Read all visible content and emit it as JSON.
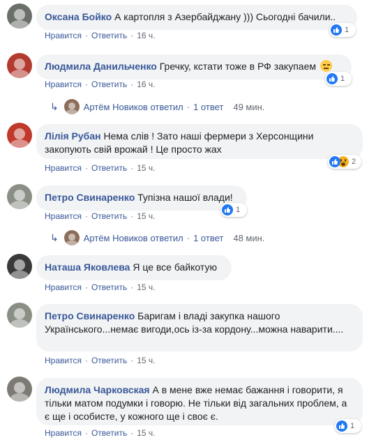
{
  "actions": {
    "like": "Нравится",
    "reply": "Ответить"
  },
  "comments": [
    {
      "author": "Оксана Бойко",
      "text": "А картопля з Азербайджану ))) Сьогодні бачили..",
      "time": "16 ч.",
      "reactions": "1",
      "avatar_color": "#6b6f6a"
    },
    {
      "author": "Людмила Данильченко",
      "text": "Гречку, кстати тоже в РФ закупаем",
      "time": "16 ч.",
      "reactions": "1",
      "avatar_color": "#b33a2f"
    },
    {
      "author": "Лілія Рубан",
      "text": "Нема слів ! Зато наші фермери з Херсонщини закопують свій врожай ! Це просто жах",
      "time": "15 ч.",
      "reactions": "2",
      "avatar_color": "#c0392b"
    },
    {
      "author": "Петро Свинаренко",
      "text": "Тупізна нашої влади!",
      "time": "15 ч.",
      "reactions": "1",
      "avatar_color": "#8a8f86"
    },
    {
      "author": "Наташа Яковлева",
      "text": "Я це все байкотую",
      "time": "15 ч.",
      "reactions": "",
      "avatar_color": "#3a3a3a"
    },
    {
      "author": "Петро Свинаренко",
      "text": "Баригам і владі закупка нашого Українського...немає вигоди,ось із-за кордону...можна наварити....",
      "time": "15 ч.",
      "reactions": "",
      "avatar_color": "#8a8f86"
    },
    {
      "author": "Людмила Чарковская",
      "text": "А в мене вже немає бажання і говорити, я тільки матом подумки і говорю. Не тільки від загальних проблем, а є ще і особисте, у кожного ще і своє є.",
      "time": "15 ч.",
      "reactions": "1",
      "avatar_color": "#7d7a75"
    }
  ],
  "replies": [
    {
      "author": "Артём Новиков",
      "verb": "ответил",
      "count": "1 ответ",
      "time": "49 мин.",
      "avatar_color": "#8c6d5a"
    },
    {
      "author": "Артём Новиков",
      "verb": "ответил",
      "count": "1 ответ",
      "time": "48 мин.",
      "avatar_color": "#8c6d5a"
    }
  ],
  "colors": {
    "link": "#385898",
    "bubble": "#f2f3f5",
    "like": "#2078f4",
    "wow": "#f7b125"
  },
  "icons": [
    "like-icon",
    "wow-icon",
    "reply-arrow-icon",
    "meh-emoji-icon"
  ]
}
